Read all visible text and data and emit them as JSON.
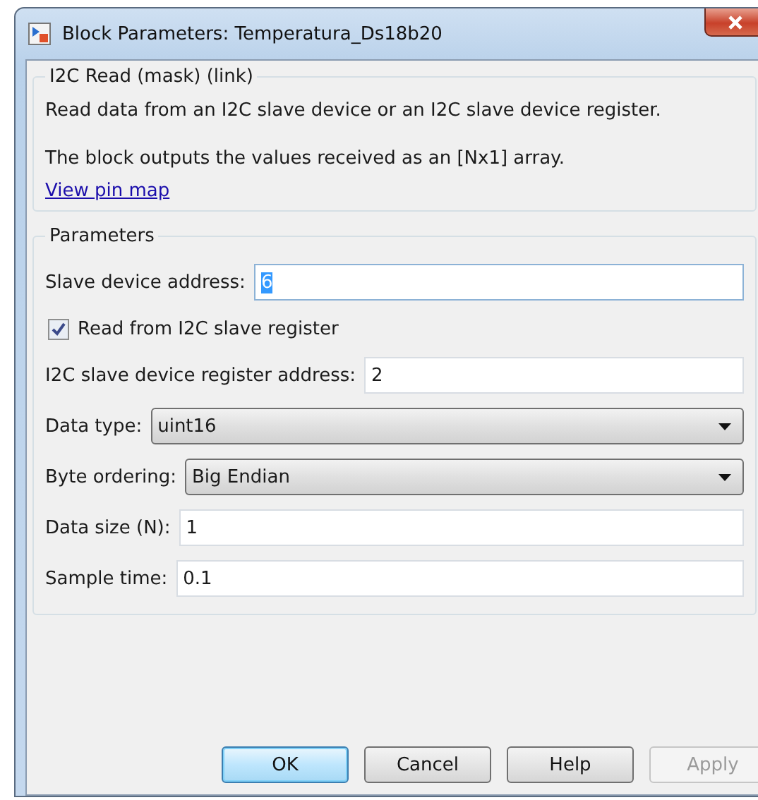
{
  "window": {
    "title": "Block Parameters: Temperatura_Ds18b20"
  },
  "description": {
    "title": "I2C Read (mask) (link)",
    "lines": [
      "Read data from an I2C slave device or an I2C slave device register.",
      "The block outputs the values received as an [Nx1] array."
    ],
    "link": "View pin map"
  },
  "parameters": {
    "title": "Parameters",
    "fields": [
      {
        "kind": "text",
        "label": "Slave device address:",
        "value": "6",
        "selected": true
      },
      {
        "kind": "checkbox",
        "label": "Read from I2C slave register",
        "checked": true
      },
      {
        "kind": "text",
        "label": "I2C slave device register address:",
        "value": "2",
        "selected": false
      },
      {
        "kind": "dropdown",
        "label": "Data type:",
        "value": "uint16"
      },
      {
        "kind": "dropdown",
        "label": "Byte ordering:",
        "value": "Big Endian"
      },
      {
        "kind": "text",
        "label": "Data size (N):",
        "value": "1",
        "selected": false
      },
      {
        "kind": "text",
        "label": "Sample time:",
        "value": "0.1",
        "selected": false
      }
    ]
  },
  "buttons": [
    {
      "label": "OK",
      "default": true,
      "disabled": false
    },
    {
      "label": "Cancel",
      "default": false,
      "disabled": false
    },
    {
      "label": "Help",
      "default": false,
      "disabled": false
    },
    {
      "label": "Apply",
      "default": false,
      "disabled": true
    }
  ]
}
